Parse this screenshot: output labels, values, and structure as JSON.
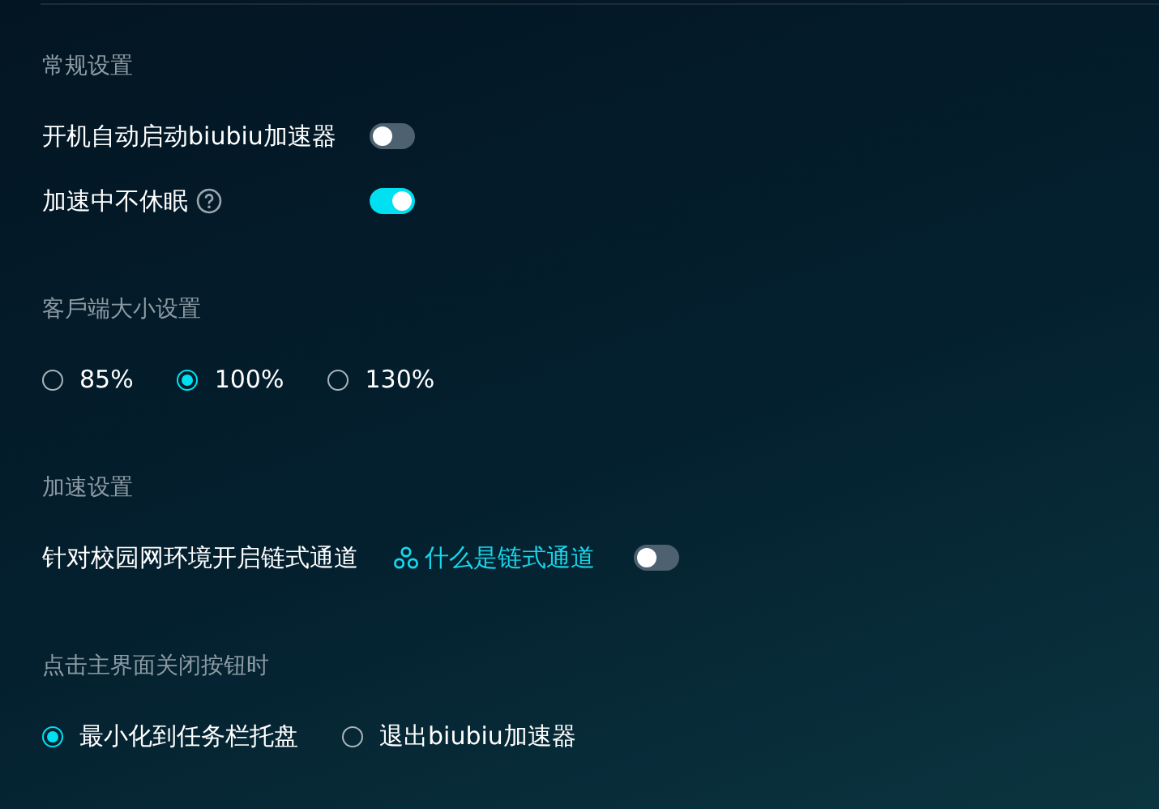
{
  "sections": [
    {
      "title": "常规设置",
      "kind": "toggles",
      "rows": [
        {
          "label": "开机自动启动biubiu加速器",
          "help": false,
          "on": false
        },
        {
          "label": "加速中不休眠",
          "help": true,
          "on": true
        }
      ]
    },
    {
      "title": "客戶端大小设置",
      "kind": "radios",
      "options": [
        {
          "label": "85%",
          "selected": false
        },
        {
          "label": "100%",
          "selected": true
        },
        {
          "label": "130%",
          "selected": false
        }
      ]
    },
    {
      "title": "加速设置",
      "kind": "link-toggle",
      "label": "针对校园网环境开启链式通道",
      "link": "什么是链式通道",
      "on": false
    },
    {
      "title": "点击主界面关闭按钮时",
      "kind": "radios",
      "options": [
        {
          "label": "最小化到任务栏托盘",
          "selected": true
        },
        {
          "label": "退出biubiu加速器",
          "selected": false
        }
      ]
    }
  ]
}
